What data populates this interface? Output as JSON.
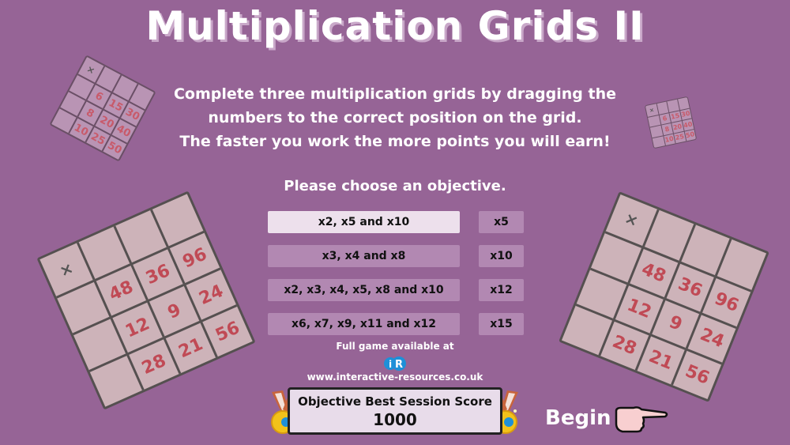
{
  "title": "Multiplication Grids II",
  "instructions": {
    "line1": "Complete three multiplication grids by dragging the",
    "line2": "numbers to the correct position on the grid.",
    "line3": "The faster you work the more points you will earn!"
  },
  "prompt": "Please choose an objective.",
  "objectives": [
    {
      "label": "x2, x5 and x10",
      "selected": true
    },
    {
      "label": "x3, x4 and x8",
      "selected": false
    },
    {
      "label": "x2, x3, x4, x5, x8 and x10",
      "selected": false
    },
    {
      "label": "x6, x7, x9, x11 and x12",
      "selected": false
    }
  ],
  "multipliers": [
    {
      "label": "x5"
    },
    {
      "label": "x10"
    },
    {
      "label": "x12"
    },
    {
      "label": "x15"
    }
  ],
  "promo": {
    "text": "Full game available at",
    "logo": "iR",
    "url": "www.interactive-resources.co.uk"
  },
  "score": {
    "label": "Objective Best Session Score",
    "value": "1000"
  },
  "begin_label": "Begin",
  "colors": {
    "background": "#966496",
    "grid_fill": "#cdb3b9",
    "grid_line": "#555050",
    "number": "#c04a55",
    "button": "#b288b2",
    "button_selected": "#ede0ec",
    "logo_blue": "#1e90d8"
  },
  "decor_grids": {
    "small": {
      "corner": "×",
      "cells": [
        [
          "×",
          "",
          "",
          ""
        ],
        [
          "",
          "6",
          "15",
          "30"
        ],
        [
          "",
          "8",
          "20",
          "40"
        ],
        [
          "",
          "10",
          "25",
          "50"
        ]
      ]
    },
    "large": {
      "corner": "×",
      "cells": [
        [
          "×",
          "",
          "",
          ""
        ],
        [
          "",
          "48",
          "36",
          "96"
        ],
        [
          "",
          "12",
          "9",
          "24"
        ],
        [
          "",
          "28",
          "21",
          "56"
        ]
      ]
    }
  }
}
